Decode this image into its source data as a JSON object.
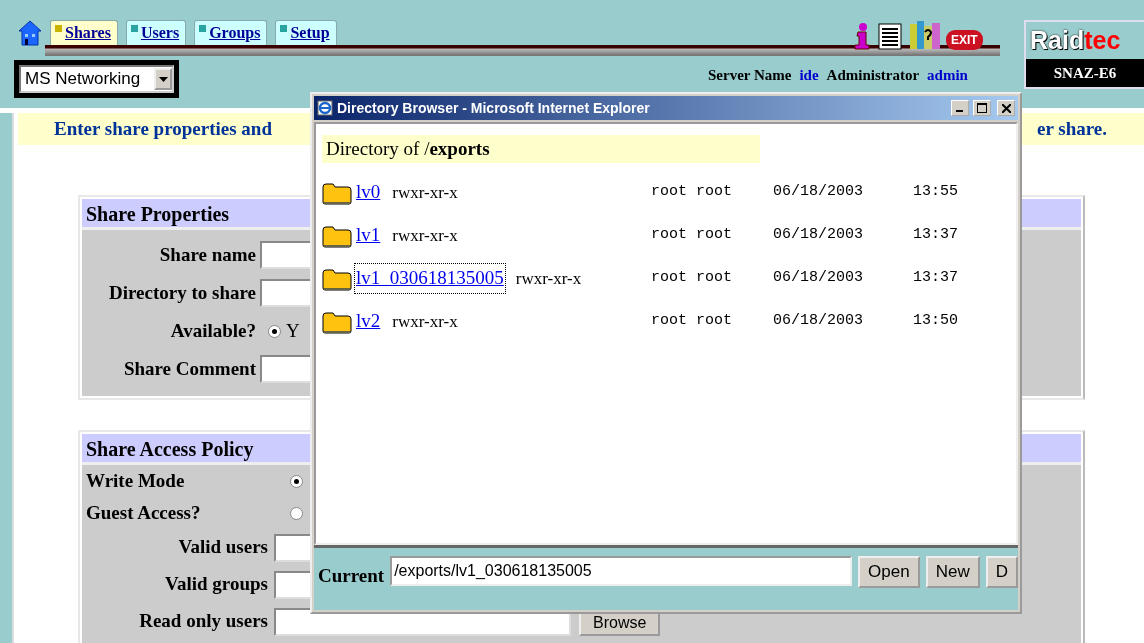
{
  "tabs": [
    {
      "label": "Shares",
      "selected": true
    },
    {
      "label": "Users",
      "selected": false
    },
    {
      "label": "Groups",
      "selected": false
    },
    {
      "label": "Setup",
      "selected": false
    }
  ],
  "toolbar": {
    "exit_label": "EXIT"
  },
  "protocol_select": {
    "value": "MS Networking"
  },
  "server": {
    "label": "Server Name",
    "value": "ide",
    "role_label": "Administrator",
    "user": "admin"
  },
  "brand": {
    "logo_part_1": "Raid",
    "logo_part_2": "tec",
    "model": "SNAZ-E6"
  },
  "banner": {
    "text_left": "Enter share properties and",
    "text_right": "er share."
  },
  "share_properties": {
    "title": "Share Properties",
    "fields": [
      {
        "kind": "text",
        "label": "Share name"
      },
      {
        "kind": "text",
        "label": "Directory to share"
      },
      {
        "kind": "radio",
        "label": "Available?",
        "checked": true,
        "option": "Y"
      },
      {
        "kind": "text",
        "label": "Share Comment"
      }
    ]
  },
  "access_policy": {
    "title": "Share Access Policy",
    "fields": [
      {
        "kind": "radio",
        "label": "Write Mode",
        "checked": true
      },
      {
        "kind": "radio",
        "label": "Guest Access?",
        "checked": false
      },
      {
        "kind": "text",
        "label": "Valid users"
      },
      {
        "kind": "text",
        "label": "Valid groups"
      },
      {
        "kind": "text",
        "label": "Read only users",
        "button": "Browse"
      }
    ]
  },
  "popup": {
    "title": "Directory Browser - Microsoft Internet Explorer",
    "heading": "Directory of /**exports**",
    "entries": [
      {
        "name": "lv0",
        "perms": "rwxr-xr-x",
        "owner": "root root",
        "date": "06/18/2003",
        "time": "13:55",
        "selected": false
      },
      {
        "name": "lv1",
        "perms": "rwxr-xr-x",
        "owner": "root root",
        "date": "06/18/2003",
        "time": "13:37",
        "selected": false
      },
      {
        "name": "lv1_030618135005",
        "perms": "rwxr-xr-x",
        "owner": "root root",
        "date": "06/18/2003",
        "time": "13:37",
        "selected": true
      },
      {
        "name": "lv2",
        "perms": "rwxr-xr-x",
        "owner": "root root",
        "date": "06/18/2003",
        "time": "13:50",
        "selected": false
      }
    ],
    "current": {
      "label": "Current",
      "value": "/exports/lv1_030618135005"
    },
    "buttons": [
      "Open",
      "New",
      "D"
    ]
  }
}
